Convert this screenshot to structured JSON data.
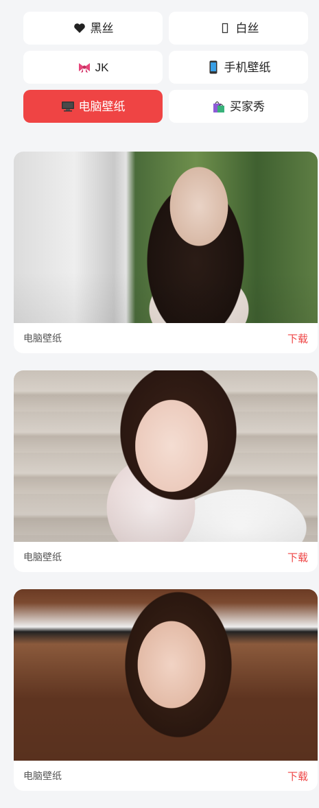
{
  "categories": [
    {
      "label": "黑丝",
      "icon": "black-heart-icon",
      "active": false
    },
    {
      "label": "白丝",
      "icon": "white-rectangle-icon",
      "active": false
    },
    {
      "label": "JK",
      "icon": "ribbon-icon",
      "active": false
    },
    {
      "label": "手机壁纸",
      "icon": "mobile-phone-icon",
      "active": false
    },
    {
      "label": "电脑壁纸",
      "icon": "desktop-computer-icon",
      "active": true
    },
    {
      "label": "买家秀",
      "icon": "shopping-bags-icon",
      "active": false
    }
  ],
  "feed": {
    "cards": [
      {
        "category": "电脑壁纸",
        "download_label": "下载",
        "image": "photo-woman-by-white-wall"
      },
      {
        "category": "电脑壁纸",
        "download_label": "下载",
        "image": "photo-woman-lace-gloves"
      },
      {
        "category": "电脑壁纸",
        "download_label": "下载",
        "image": "photo-woman-at-piano"
      }
    ]
  },
  "colors": {
    "accent": "#ef4444",
    "background": "#f4f5f7",
    "card": "#ffffff"
  }
}
